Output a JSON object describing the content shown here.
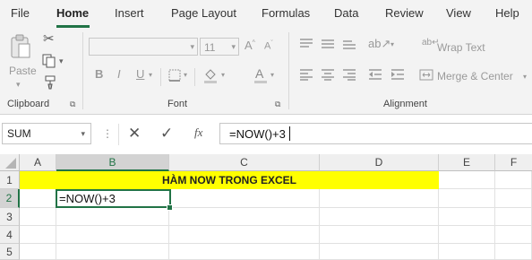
{
  "menu": {
    "tabs": [
      "File",
      "Home",
      "Insert",
      "Page Layout",
      "Formulas",
      "Data",
      "Review",
      "View",
      "Help"
    ],
    "active": "Home"
  },
  "ribbon": {
    "clipboard": {
      "paste_label": "Paste",
      "group_label": "Clipboard"
    },
    "font": {
      "font_size": "11",
      "group_label": "Font"
    },
    "alignment": {
      "wrap_text_label": "Wrap Text",
      "merge_center_label": "Merge & Center",
      "group_label": "Alignment"
    }
  },
  "formula_bar": {
    "name_box": "SUM",
    "fx_label": "fx",
    "formula": "=NOW()+3"
  },
  "sheet": {
    "columns": [
      "A",
      "B",
      "C",
      "D",
      "E",
      "F"
    ],
    "rows": [
      "1",
      "2",
      "3",
      "4",
      "5"
    ],
    "banner_text": "HÀM NOW TRONG EXCEL",
    "active_cell_value": "=NOW()+3",
    "colors": {
      "banner_bg": "#ffff00",
      "accent": "#217346"
    }
  }
}
